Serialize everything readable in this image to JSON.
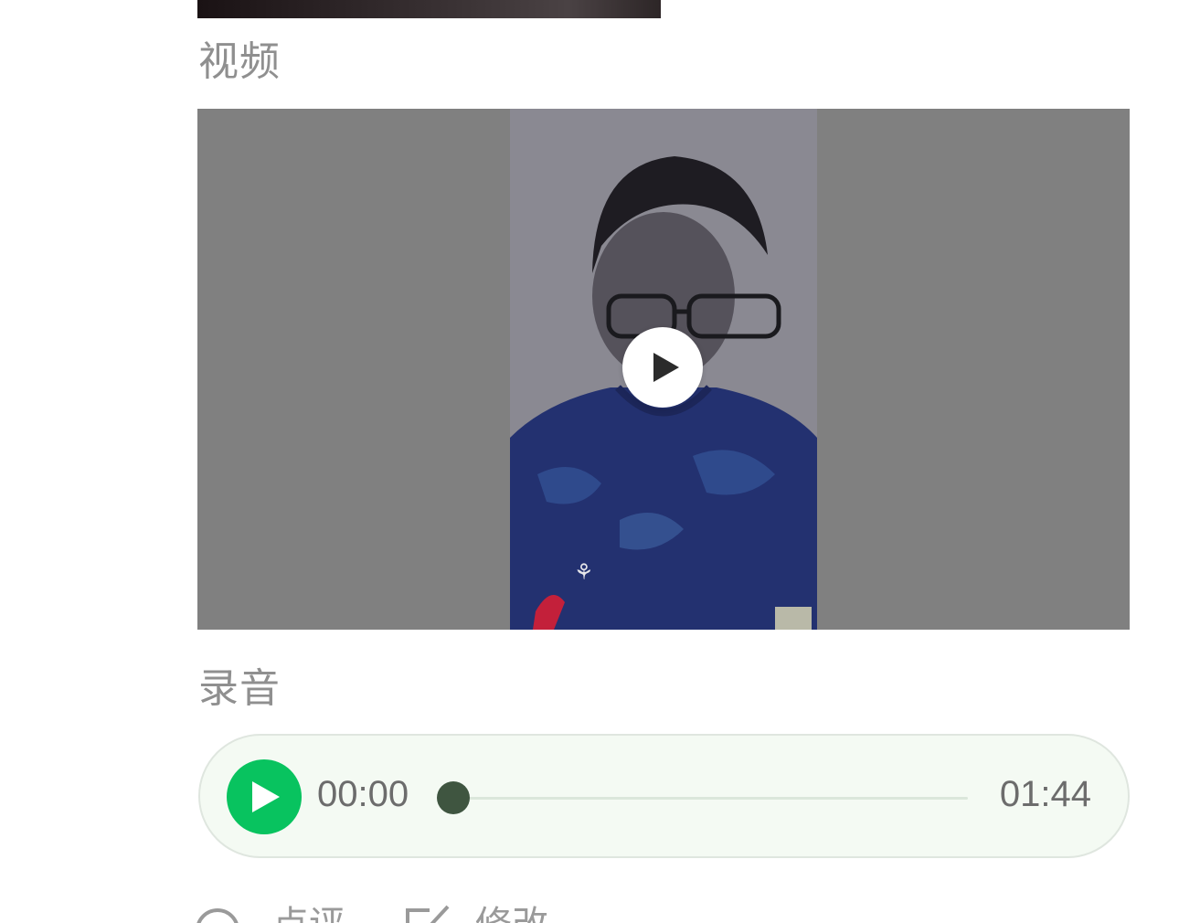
{
  "sections": {
    "video_label": "视频",
    "audio_label": "录音"
  },
  "video": {
    "play_icon": "play-icon"
  },
  "audio": {
    "current_time": "00:00",
    "total_time": "01:44",
    "progress": 0,
    "accent_color": "#08c35f"
  },
  "actions": {
    "comment_label": "点评",
    "edit_label": "修改"
  }
}
